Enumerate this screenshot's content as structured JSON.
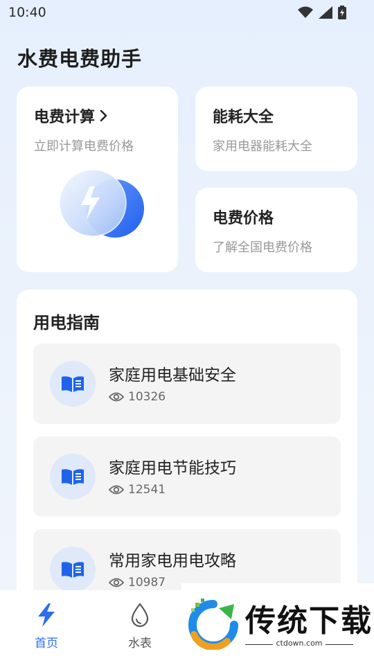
{
  "status_bar": {
    "time": "10:40"
  },
  "app": {
    "title": "水费电费助手"
  },
  "cards": {
    "calc": {
      "title": "电费计算",
      "subtitle": "立即计算电费价格"
    },
    "energy": {
      "title": "能耗大全",
      "subtitle": "家用电器能耗大全"
    },
    "price": {
      "title": "电费价格",
      "subtitle": "了解全国电费价格"
    }
  },
  "guide": {
    "heading": "用电指南",
    "items": [
      {
        "title": "家庭用电基础安全",
        "views": "10326"
      },
      {
        "title": "家庭用电节能技巧",
        "views": "12541"
      },
      {
        "title": "常用家电用电攻略",
        "views": "10987"
      }
    ]
  },
  "nav": {
    "items": [
      {
        "label": "首页",
        "icon": "bolt-icon",
        "active": true
      },
      {
        "label": "水表",
        "icon": "water-drop-icon",
        "active": false
      }
    ]
  },
  "watermark": {
    "text": "传统下载",
    "url": "ctdown.com"
  },
  "colors": {
    "accent": "#2f6ef0",
    "card_bg": "#ffffff",
    "item_bg": "#f4f4f5"
  }
}
